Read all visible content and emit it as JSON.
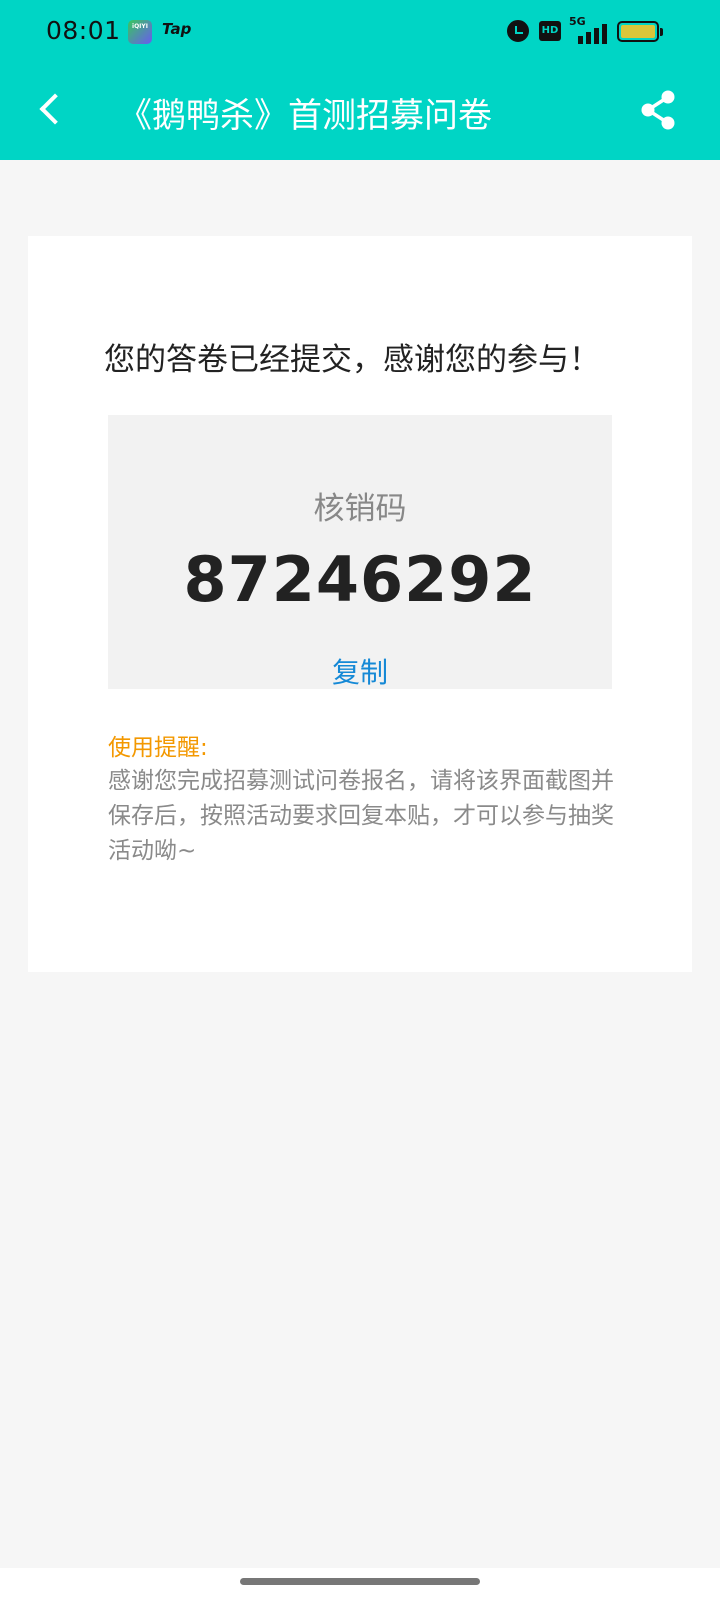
{
  "status_bar": {
    "time": "08:01",
    "iqiyi_label": "iQIYI",
    "tap_label": "Tap",
    "network": "5G",
    "hd": "HD",
    "icons": [
      "alarm-icon",
      "hd-icon",
      "signal-5g-icon",
      "battery-icon"
    ]
  },
  "header": {
    "title": "《鹅鸭杀》首测招募问卷",
    "back_icon": "chevron-left-icon",
    "share_icon": "share-icon",
    "background_color": "#00d5c5"
  },
  "card": {
    "message": "您的答卷已经提交，感谢您的参与！",
    "code_label": "核销码",
    "code_value": "87246292",
    "copy_label": "复制",
    "reminder_title": "使用提醒:",
    "reminder_text": "感谢您完成招募测试问卷报名，请将该界面截图并保存后，按照活动要求回复本贴，才可以参与抽奖活动呦~"
  },
  "colors": {
    "accent": "#00d5c5",
    "link": "#1589d6",
    "warning": "#f39800"
  }
}
